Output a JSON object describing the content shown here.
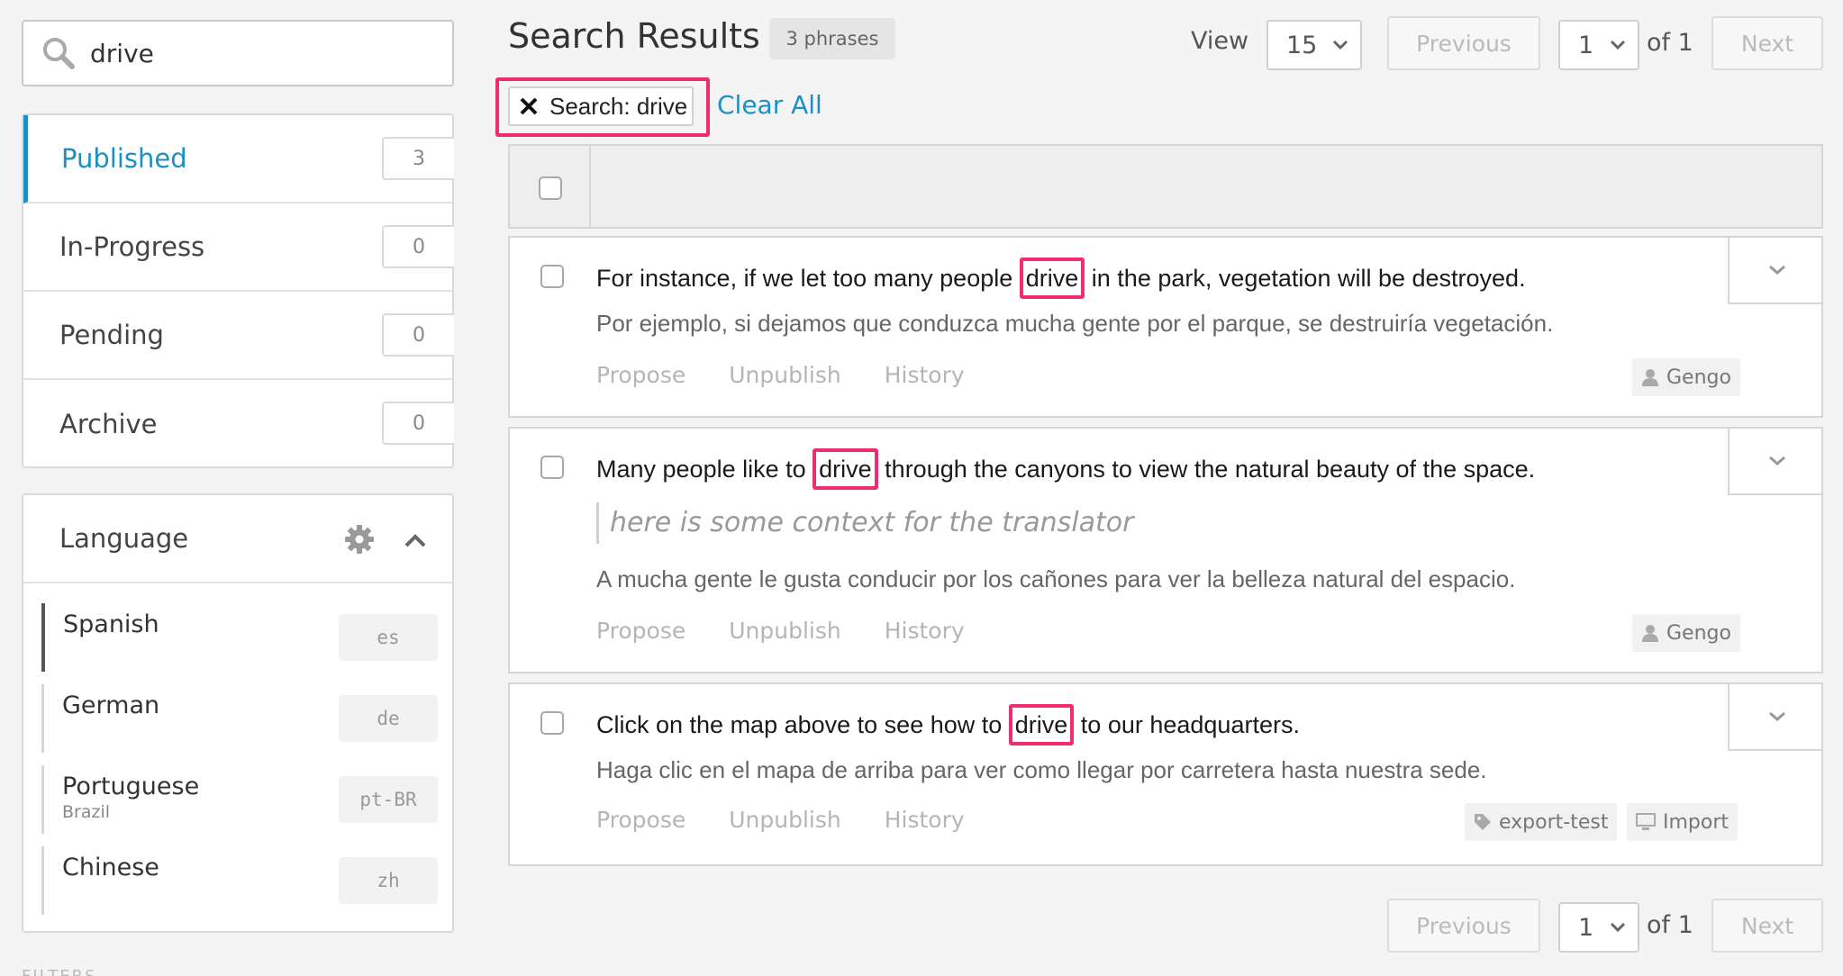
{
  "search": {
    "value": "drive"
  },
  "statuses": [
    {
      "label": "Published",
      "count": "3"
    },
    {
      "label": "In-Progress",
      "count": "0"
    },
    {
      "label": "Pending",
      "count": "0"
    },
    {
      "label": "Archive",
      "count": "0"
    }
  ],
  "language_panel": {
    "title": "Language",
    "items": [
      {
        "name": "Spanish",
        "sub": "",
        "code": "es"
      },
      {
        "name": "German",
        "sub": "",
        "code": "de"
      },
      {
        "name": "Portuguese",
        "sub": "Brazil",
        "code": "pt-BR"
      },
      {
        "name": "Chinese",
        "sub": "",
        "code": "zh"
      }
    ]
  },
  "filters_label": "FILTERS",
  "header": {
    "title": "Search Results",
    "phrase_count": "3 phrases",
    "view_label": "View",
    "view_value": "15"
  },
  "pagination": {
    "previous": "Previous",
    "next": "Next",
    "page": "1",
    "of": "of 1"
  },
  "filter_chip": {
    "label": "Search: drive"
  },
  "clear_all": "Clear All",
  "results": [
    {
      "source_before": "For instance, if we let too many people ",
      "source_match": "drive",
      "source_after": " in the park, vegetation will be destroyed.",
      "context": "",
      "target": "Por ejemplo, si dejamos que conduzca mucha gente por el parque, se destruiría vegetación.",
      "tags": [
        {
          "label": "Gengo",
          "icon": "user-icon"
        }
      ]
    },
    {
      "source_before": "Many people like to ",
      "source_match": "drive",
      "source_after": " through the canyons to view the natural beauty of the space.",
      "context": "here is some context for the translator",
      "target": "A mucha gente le gusta conducir por los cañones para ver la belleza natural del espacio.",
      "tags": [
        {
          "label": "Gengo",
          "icon": "user-icon"
        }
      ]
    },
    {
      "source_before": "Click on the map above to see how to ",
      "source_match": "drive",
      "source_after": " to our headquarters.",
      "context": "",
      "target": "Haga clic en el mapa de arriba para ver como llegar por carretera hasta nuestra sede.",
      "tags": [
        {
          "label": "export-test",
          "icon": "tag-icon"
        },
        {
          "label": "Import",
          "icon": "monitor-icon"
        }
      ]
    }
  ],
  "actions": {
    "propose": "Propose",
    "unpublish": "Unpublish",
    "history": "History"
  },
  "colors": {
    "accent": "#1c8fc4",
    "highlight": "#ee2c6e"
  }
}
